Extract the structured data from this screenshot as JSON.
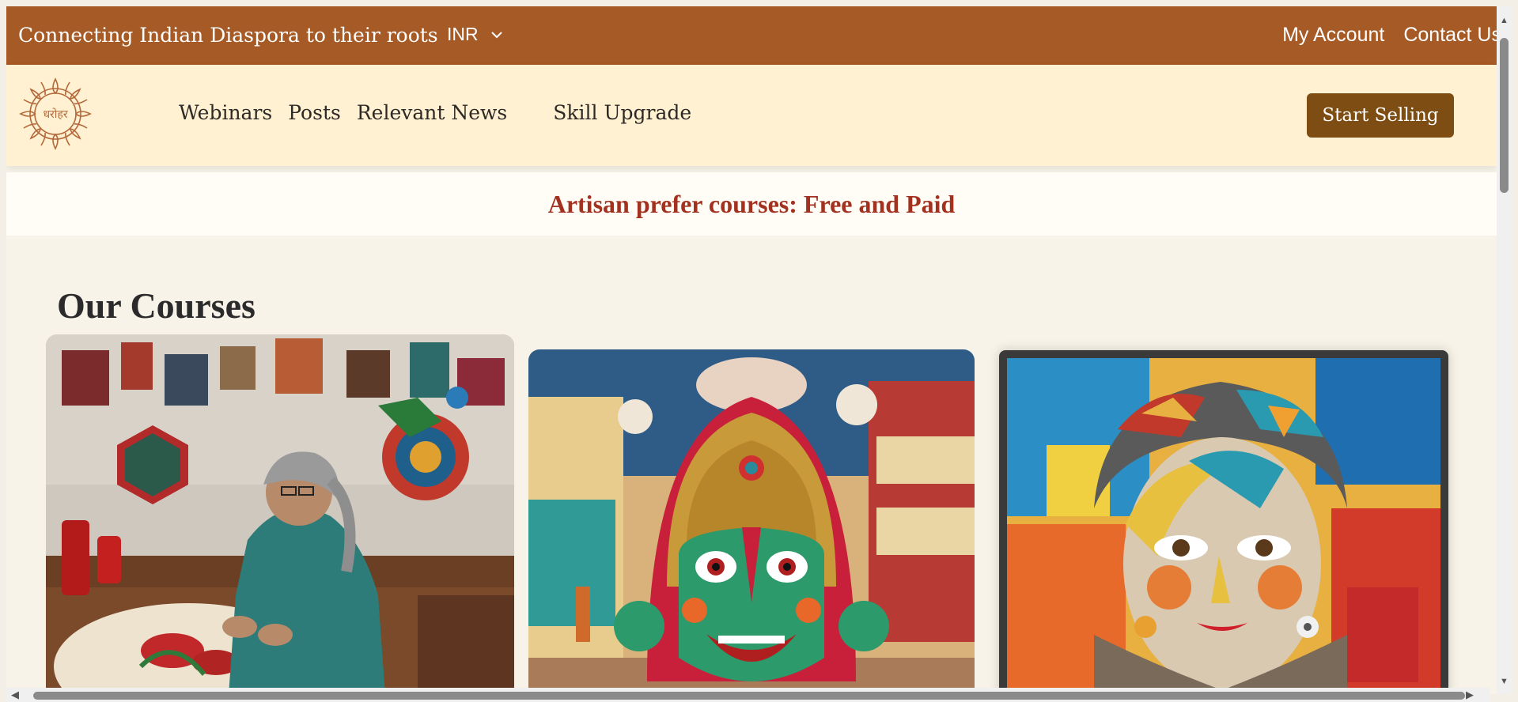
{
  "topbar": {
    "tagline": "Connecting Indian Diaspora to their roots",
    "currency": "INR",
    "my_account": "My Account",
    "contact_us": "Contact Us"
  },
  "logo": {
    "text": "धरोहर"
  },
  "nav": {
    "items": [
      "Webinars",
      "Posts",
      "Relevant News",
      "Skill Upgrade"
    ],
    "start_selling": "Start Selling"
  },
  "banner": {
    "text": "Artisan prefer courses: Free and Paid"
  },
  "courses": {
    "title": "Our Courses"
  },
  "colors": {
    "topbar": "#a65a25",
    "navbar": "#fff1d2",
    "button": "#7d4d13",
    "banner_text": "#a33120"
  },
  "icons": [
    "chevron-down-icon",
    "mandala-logo"
  ]
}
